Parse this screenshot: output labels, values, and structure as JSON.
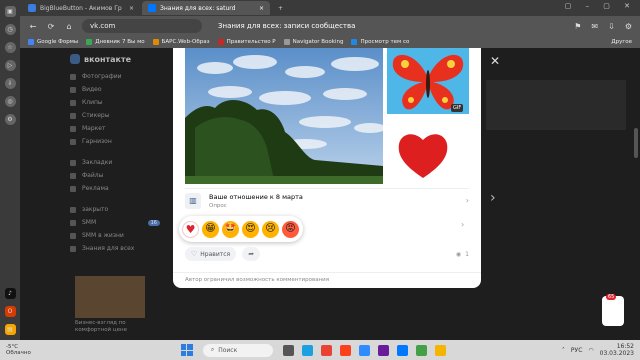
{
  "browser": {
    "tabs": [
      {
        "label": "BigBlueButton - Акимов Гр"
      },
      {
        "label": "Знания для всех: saturd"
      }
    ],
    "url": "vk.com",
    "page_title": "Знания для всех: записи сообщества",
    "bookmarks": [
      "Google Формы",
      "Дневник 7 Вы мо",
      "БАРС.Web-Образ",
      "Правительство Р",
      "Navigator Booking",
      "Просмотр тем со"
    ],
    "other_bookmarks": "Другое"
  },
  "vk": {
    "brand": "вконтакте",
    "sidebar": [
      "Фотографии",
      "Видео",
      "Клипы",
      "Стикеры",
      "Маркет",
      "Гарнизон",
      "Закладки",
      "Файлы",
      "Реклама",
      "закрыто",
      "SMM",
      "SMM в жизни",
      "Знания для всех"
    ],
    "sidebar_badge": "16",
    "feed_caption": "Бизнес-взгляд по комфортной цене"
  },
  "post": {
    "gif_badge": "GIF",
    "poll_title": "Ваше отношение к 8 марта",
    "poll_type": "Опрос",
    "like_label": "Нравится",
    "views": "1",
    "comments_note": "Автор ограничил возможность комментирования",
    "reactions": [
      "♥",
      "😁",
      "🤩",
      "😍",
      "😢",
      "😡"
    ]
  },
  "taskbar": {
    "weather_temp": "-5°C",
    "weather_desc": "Облачно",
    "search": "Поиск",
    "lang": "РУС",
    "time": "16:52",
    "date": "03.03.2023"
  },
  "sticker_badge": "65",
  "colors": {
    "vk_blue": "#0077ff",
    "heart_red": "#e0242f",
    "sky": "#4fb6e8"
  }
}
